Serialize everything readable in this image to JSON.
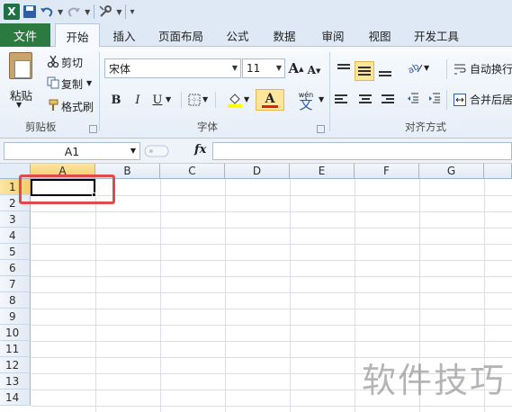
{
  "quick_access": {
    "app_icon": "excel-icon",
    "items": [
      "save-icon",
      "undo-icon",
      "redo-icon",
      "tools-icon",
      "customize-icon"
    ]
  },
  "tabs": {
    "file": "文件",
    "items": [
      "开始",
      "插入",
      "页面布局",
      "公式",
      "数据",
      "审阅",
      "视图",
      "开发工具"
    ],
    "active": "开始"
  },
  "clipboard": {
    "paste": "粘贴",
    "cut": "剪切",
    "copy": "复制",
    "format_painter": "格式刷",
    "label": "剪贴板"
  },
  "font": {
    "name": "宋体",
    "size": "11",
    "bold": "B",
    "italic": "I",
    "underline": "U",
    "font_color_letter": "A",
    "grow": "A",
    "shrink": "A",
    "wen": "wén",
    "wen_char": "文",
    "label": "字体"
  },
  "alignment": {
    "wrap_text": "自动换行",
    "merge_center": "合并后居",
    "label": "对齐方式"
  },
  "formula_bar": {
    "name_box": "A1",
    "fx": "fx",
    "content": ""
  },
  "sheet": {
    "columns": [
      "A",
      "B",
      "C",
      "D",
      "E",
      "F",
      "G"
    ],
    "rows": [
      "1",
      "2",
      "3",
      "4",
      "5",
      "6",
      "7",
      "8",
      "9",
      "10",
      "11",
      "12",
      "13",
      "14"
    ],
    "selected_cell": "A1"
  },
  "colors": {
    "file_tab": "#2b7a3f",
    "highlight": "#fde59b",
    "annotation": "#e04a4a",
    "font_color": "#e02020"
  },
  "watermark": "软件技巧"
}
